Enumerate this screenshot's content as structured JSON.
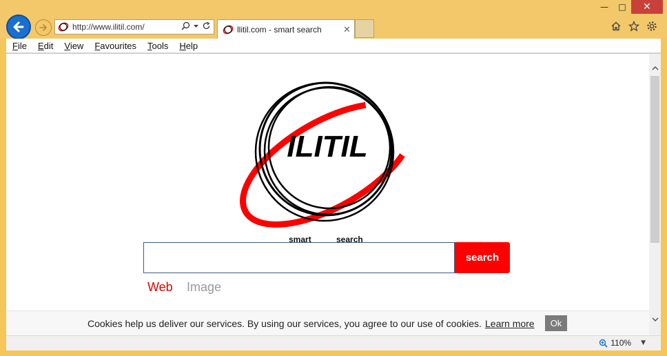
{
  "window": {
    "minimize_glyph": "—",
    "maximize_glyph": "□",
    "close_glyph": "✕"
  },
  "address_bar": {
    "url": "http://www.ilitil.com/",
    "search_icon": "search-icon",
    "dropdown_icon": "chevron-down-icon",
    "refresh_icon": "refresh-icon"
  },
  "tab": {
    "title": "llitil.com - smart search",
    "close_glyph": "✕"
  },
  "menu": {
    "items": [
      {
        "label": "File",
        "underline": "F",
        "rest": "ile"
      },
      {
        "label": "Edit",
        "underline": "E",
        "rest": "dit"
      },
      {
        "label": "View",
        "underline": "V",
        "rest": "iew"
      },
      {
        "label": "Favourites",
        "underline": "F",
        "rest": "avourites"
      },
      {
        "label": "Tools",
        "underline": "T",
        "rest": "ools"
      },
      {
        "label": "Help",
        "underline": "H",
        "rest": "elp"
      }
    ]
  },
  "page": {
    "logo_text": "ILITIL",
    "logo_sub_left": "smart",
    "logo_sub_right": "search",
    "search_button": "search",
    "search_value": "",
    "tab_web": "Web",
    "tab_image": "Image"
  },
  "cookie": {
    "text": "Cookies help us deliver our services. By using our services, you agree to our use of cookies.",
    "learn_more": "Learn more",
    "ok": "Ok"
  },
  "status": {
    "zoom": "110%"
  },
  "colors": {
    "brand_red": "#ff0000",
    "ie_blue": "#1a6fd0",
    "frame": "#f5c65a"
  }
}
